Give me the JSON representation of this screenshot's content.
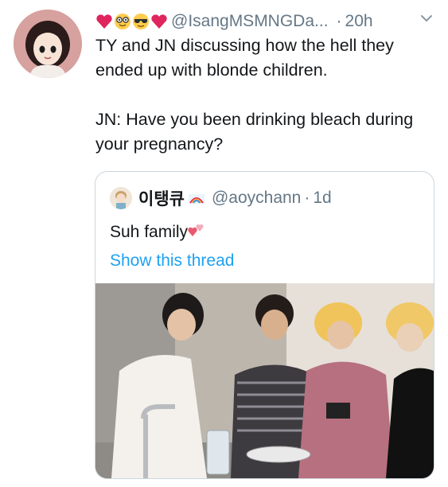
{
  "tweet": {
    "emojis": [
      "red-heart-icon",
      "nerd-face-icon",
      "sunglasses-face-icon",
      "red-heart-icon"
    ],
    "handle": "@IsangMSMNGDa...",
    "dot": "·",
    "time": "20h",
    "text": "TY and JN discussing how the hell they ended up with blonde children.\n\nJN: Have you been drinking bleach during your pregnancy?"
  },
  "quoted": {
    "name": "이탱큐",
    "handle": "@aoychann",
    "dot": "·",
    "time": "1d",
    "text": "Suh family",
    "link": "Show this thread"
  },
  "colors": {
    "link": "#1da1f2",
    "muted": "#657786",
    "border": "#ccd6dd"
  }
}
